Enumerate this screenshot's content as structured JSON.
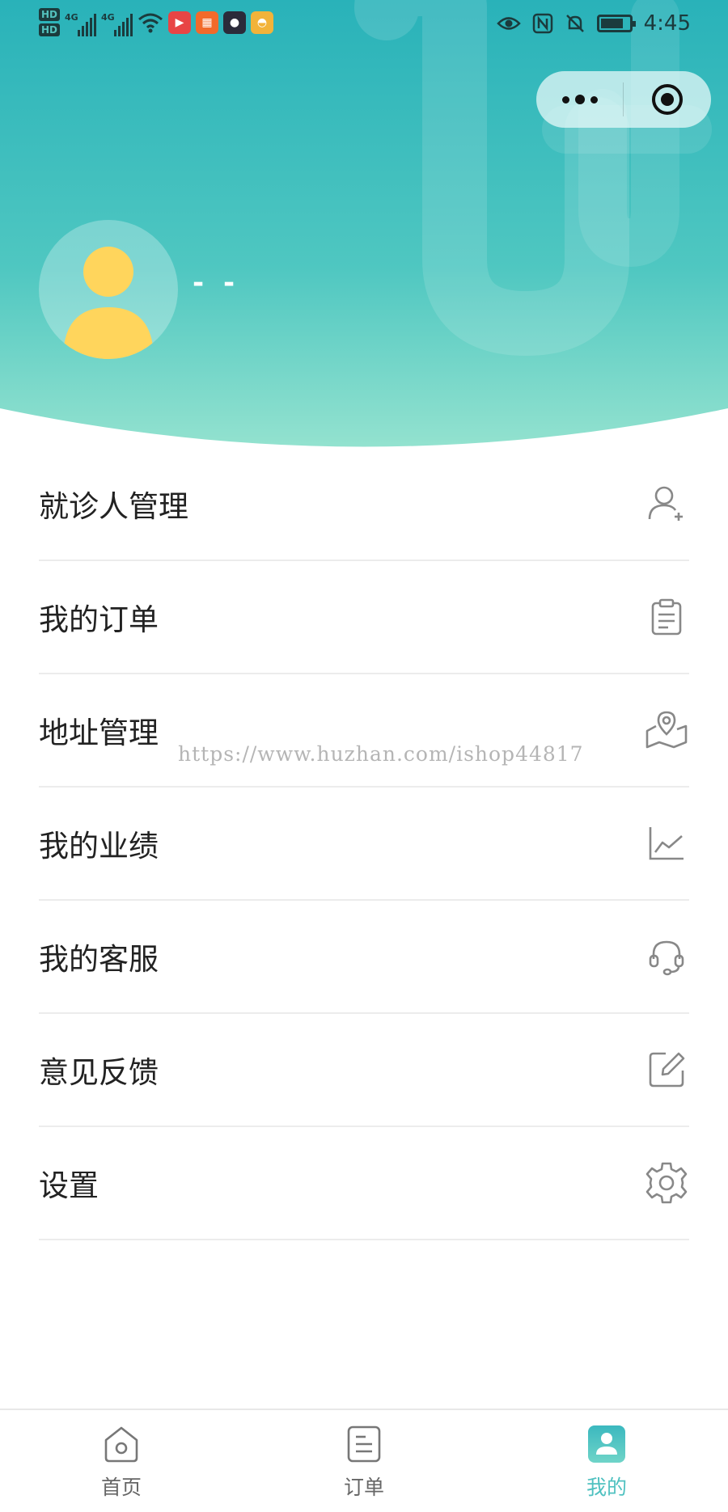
{
  "status_bar": {
    "time": "4:45",
    "network_1": "4G",
    "network_2": "4G",
    "hd_1": "HD",
    "hd_2": "HD",
    "battery_level": 0.8,
    "icons": [
      "hd-icon",
      "signal-icon",
      "wifi-icon",
      "video-app-icon",
      "grid-app-icon",
      "avatar-app-icon",
      "cup-app-icon",
      "eye-icon",
      "nfc-icon",
      "bell-off-icon",
      "battery-icon"
    ]
  },
  "header": {
    "user_name": "- -",
    "colors": {
      "gradient_top": "#28b3b8",
      "gradient_bottom": "#8fe0cf",
      "avatar_fill": "#ffd55c"
    }
  },
  "capsule": {
    "more_icon": "more-dots-icon",
    "close_icon": "target-close-icon"
  },
  "menu": {
    "items": [
      {
        "label": "就诊人管理",
        "icon": "add-user-icon"
      },
      {
        "label": "我的订单",
        "icon": "clipboard-icon"
      },
      {
        "label": "地址管理",
        "icon": "map-pin-icon"
      },
      {
        "label": "我的业绩",
        "icon": "line-chart-icon"
      },
      {
        "label": "我的客服",
        "icon": "headset-icon"
      },
      {
        "label": "意见反馈",
        "icon": "edit-icon"
      },
      {
        "label": "设置",
        "icon": "gear-icon"
      }
    ]
  },
  "watermark": "https://www.huzhan.com/ishop44817",
  "tabbar": {
    "tabs": [
      {
        "label": "首页",
        "icon": "home-icon",
        "active": false
      },
      {
        "label": "订单",
        "icon": "order-icon",
        "active": false
      },
      {
        "label": "我的",
        "icon": "profile-icon",
        "active": true
      }
    ],
    "active_color": "#4fc1c0"
  }
}
